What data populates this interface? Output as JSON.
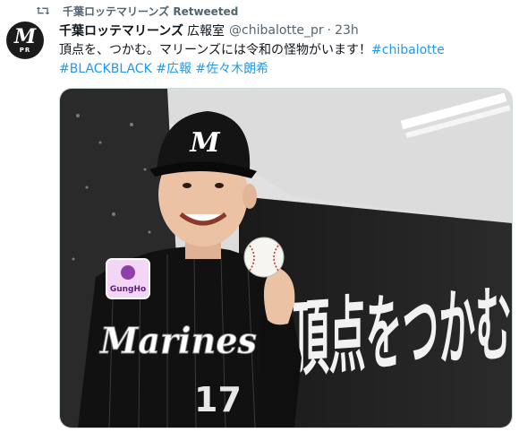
{
  "retweet": {
    "icon": "retweet-icon",
    "label": "千葉ロッテマリーンズ Retweeted"
  },
  "author": {
    "avatar_letter": "M",
    "avatar_badge": "PR",
    "name": "千葉ロッテマリーンズ",
    "subtitle": "広報室",
    "handle": "@chibalotte_pr",
    "separator": "·",
    "time": "23h"
  },
  "tweet": {
    "line1_text": "頂点を、つかむ。マリーンズには令和の怪物がいます！",
    "line1_tag": "#chibalotte",
    "tag2": "#BLACKBLACK",
    "tag3": "#広報",
    "tag4": "#佐々木朗希"
  },
  "photo": {
    "cap_letter": "M",
    "patch_text": "GungHo",
    "jersey_text": "Marines",
    "jersey_number": "17",
    "banner_text": "頂点をつかむ"
  },
  "colors": {
    "link": "#1d9bf0",
    "muted": "#536471",
    "text": "#0f1419"
  }
}
